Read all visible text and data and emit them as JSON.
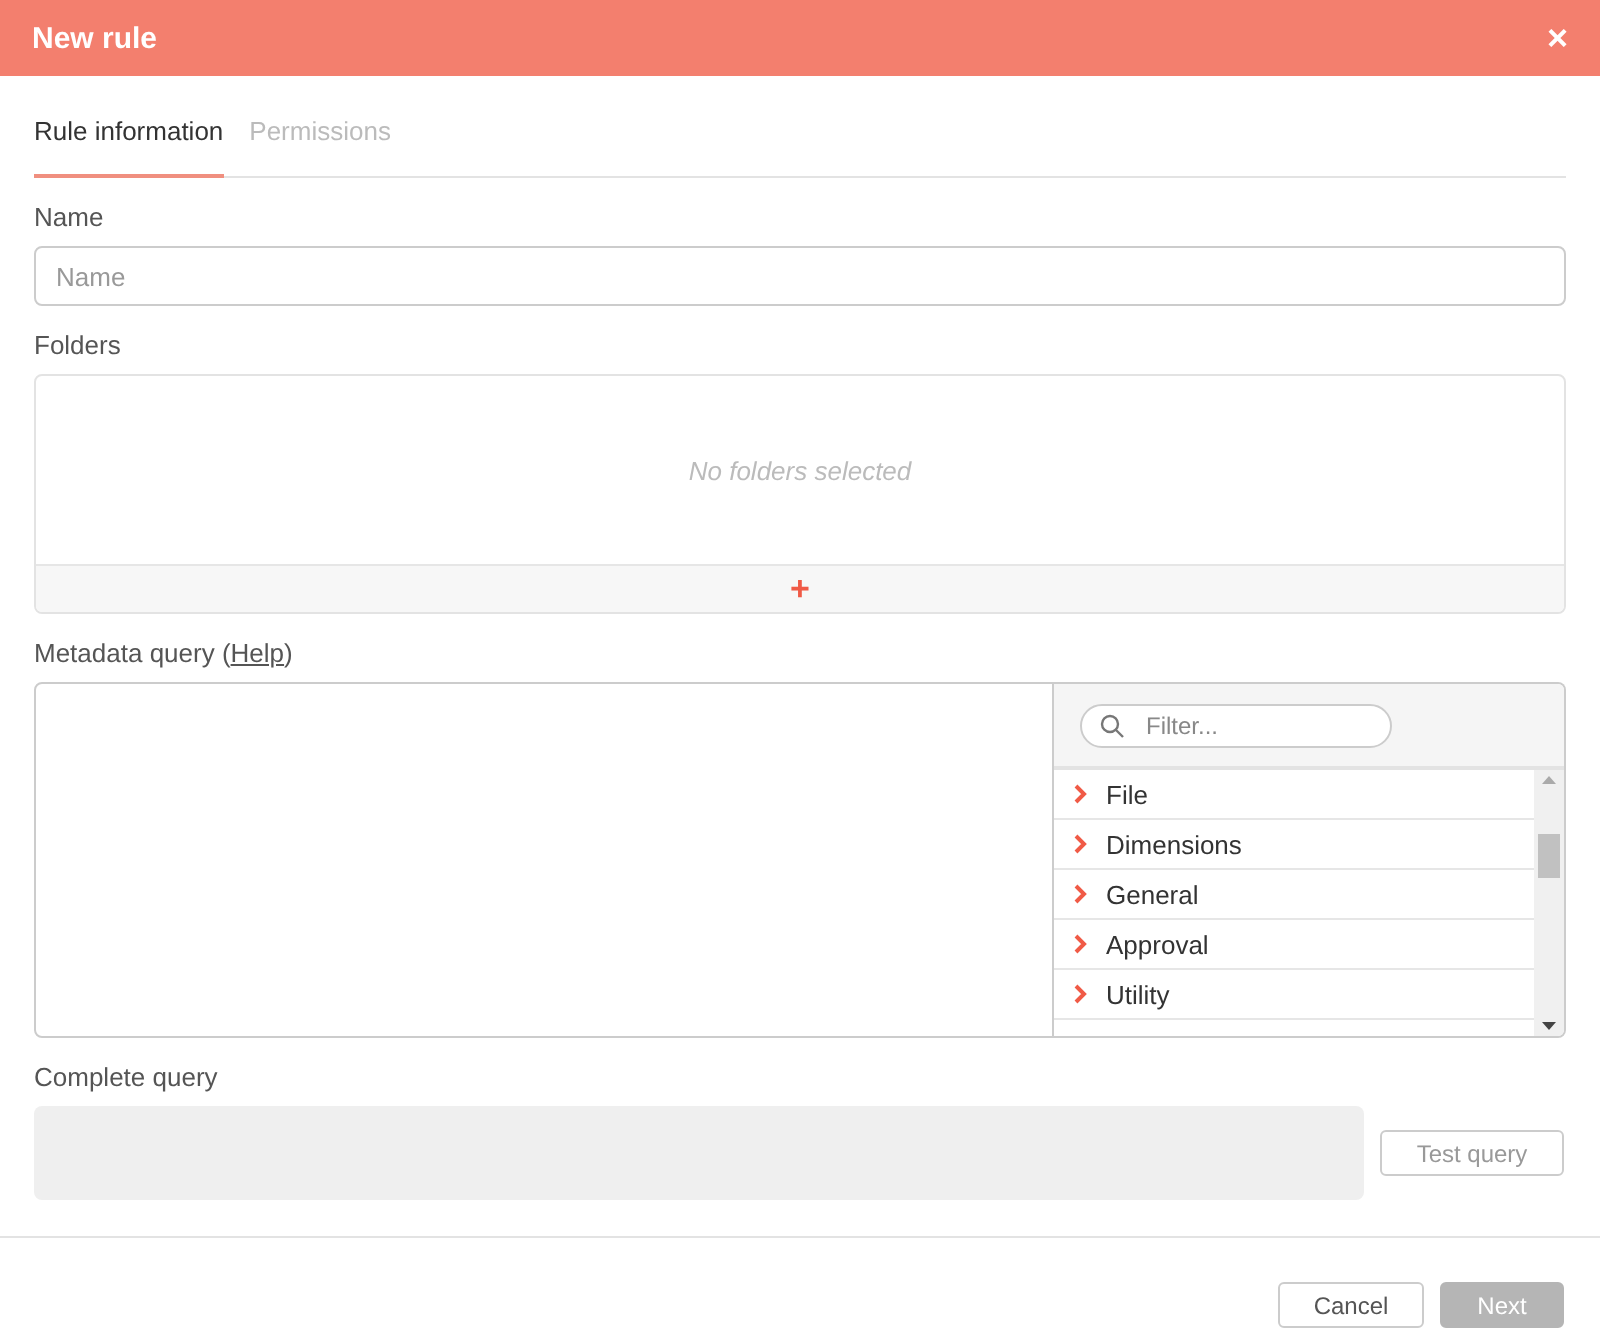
{
  "window": {
    "title": "New rule",
    "close": "×"
  },
  "tabs": [
    {
      "label": "Rule information",
      "selected": true
    },
    {
      "label": "Permissions",
      "selected": false
    }
  ],
  "name_field": {
    "label": "Name",
    "placeholder": "Name"
  },
  "folders": {
    "label": "Folders",
    "empty_text": "No folders selected",
    "add": "+"
  },
  "metadata_query": {
    "label_before": "Metadata query (",
    "link": "Help",
    "label_after": ")",
    "filter_placeholder": "Filter...",
    "categories": [
      {
        "label": "File",
        "expanded": false
      },
      {
        "label": "Dimensions",
        "expanded": false
      },
      {
        "label": "General",
        "expanded": false
      },
      {
        "label": "Approval",
        "expanded": false
      },
      {
        "label": "Utility",
        "expanded": false
      }
    ]
  },
  "complete_query": {
    "label": "Complete query",
    "test_button": {
      "label": "Test query",
      "disabled": true
    }
  },
  "footer": [
    {
      "label": "Cancel",
      "kind": "secondary",
      "disabled": false
    },
    {
      "label": "Next",
      "kind": "primary",
      "disabled": true
    }
  ]
}
